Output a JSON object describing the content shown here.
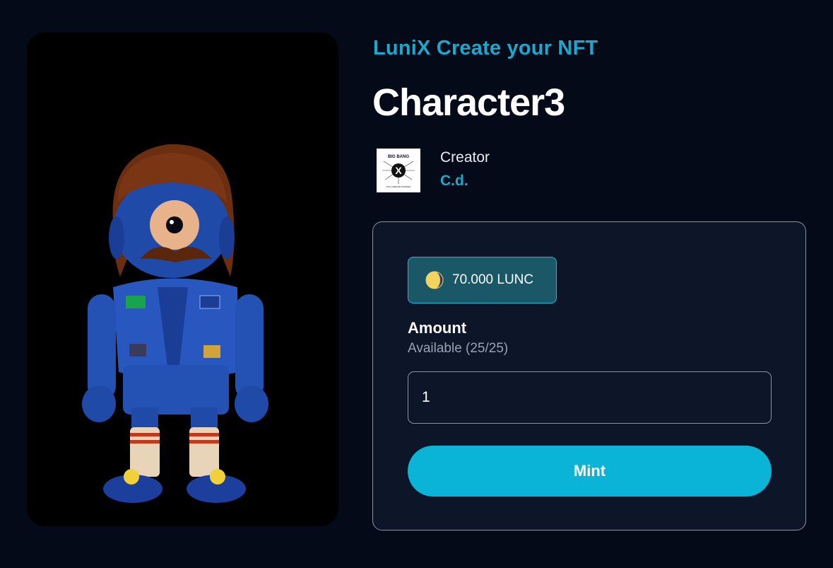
{
  "collection": {
    "title": "LuniX Create your NFT"
  },
  "nft": {
    "name": "Character3",
    "image_icon": "nft-character-image"
  },
  "creator": {
    "label": "Creator",
    "name": "C.d.",
    "logo_text_top": "BIG BANG",
    "logo_letter": "X",
    "logo_text_bottom": "PLAY CREATE TRADING"
  },
  "mint": {
    "price": "70.000 LUNC",
    "coin_icon": "lunc-coin-icon",
    "amount_label": "Amount",
    "available": "Available (25/25)",
    "amount_value": "1",
    "button_label": "Mint"
  },
  "colors": {
    "background": "#050a18",
    "accent": "#1aa9cc",
    "button": "#0ab4d6",
    "panel": "#0d1628"
  }
}
